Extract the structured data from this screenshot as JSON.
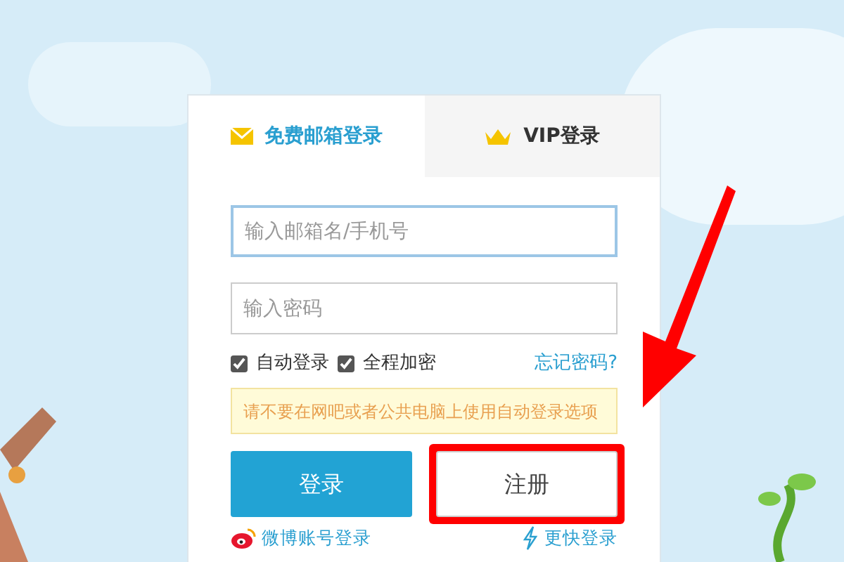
{
  "tabs": [
    {
      "label": "免费邮箱登录",
      "selected": true
    },
    {
      "label": "VIP登录",
      "selected": false
    }
  ],
  "fields": [
    {
      "placeholder": "输入邮箱名/手机号",
      "focused": true
    },
    {
      "placeholder": "输入密码",
      "focused": false
    }
  ],
  "options": [
    {
      "label": "自动登录",
      "checked": true
    },
    {
      "label": "全程加密",
      "checked": true
    }
  ],
  "forgot_link": "忘记密码?",
  "notice": "请不要在网吧或者公共电脑上使用自动登录选项",
  "buttons": [
    {
      "label": "登录",
      "kind": "primary",
      "highlighted": false
    },
    {
      "label": "注册",
      "kind": "secondary",
      "highlighted": true
    }
  ],
  "links": [
    {
      "label": "微博账号登录"
    },
    {
      "label": "更快登录"
    }
  ]
}
